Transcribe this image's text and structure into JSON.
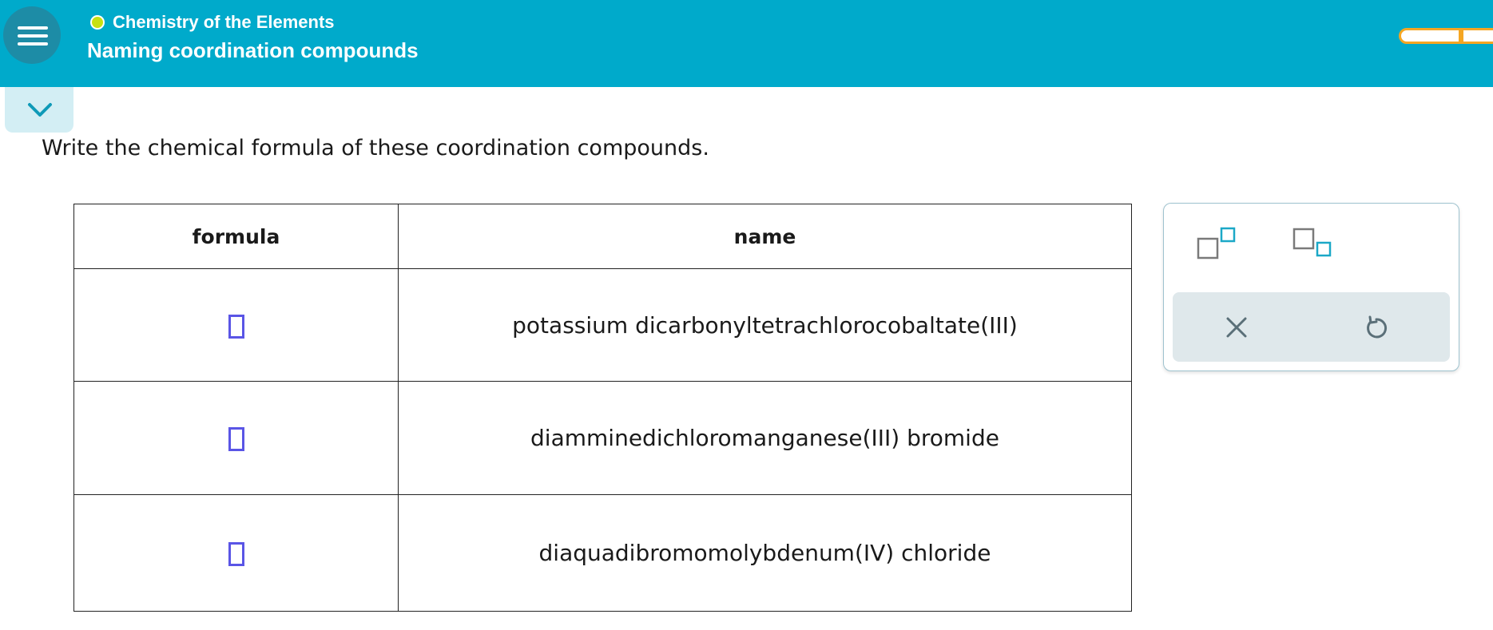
{
  "header": {
    "subject": "Chemistry of the Elements",
    "topic": "Naming coordination compounds",
    "status_color": "#c7e012",
    "accent_color": "#00aacb",
    "progress_color": "#f5a623"
  },
  "question": {
    "instruction": "Write the chemical formula of these coordination compounds."
  },
  "table": {
    "columns": [
      "formula",
      "name"
    ],
    "rows": [
      {
        "formula": "",
        "name": "potassium dicarbonyltetrachlorocobaltate(III)"
      },
      {
        "formula": "",
        "name": "diamminedichloromanganese(III) bromide"
      },
      {
        "formula": "",
        "name": "diaquadibromomolybdenum(IV) chloride"
      }
    ]
  },
  "tools": {
    "icons": [
      "superscript-icon",
      "subscript-icon",
      "clear-icon",
      "undo-icon"
    ]
  }
}
